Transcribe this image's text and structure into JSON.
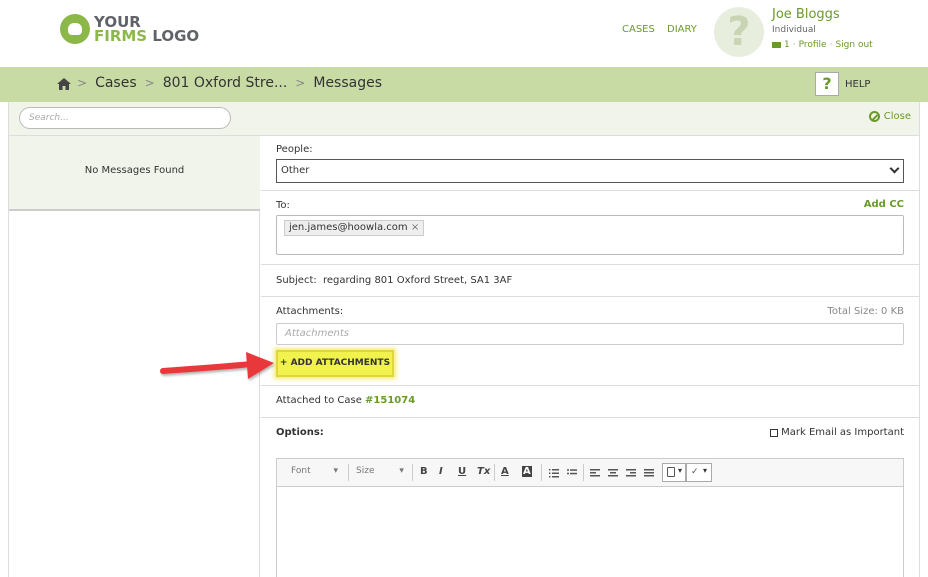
{
  "header": {
    "logo_line1": "YOUR",
    "logo_line2a": "FIRMS",
    "logo_line2b": " LOGO",
    "nav": [
      "CASES",
      "DIARY"
    ],
    "avatar_glyph": "?",
    "user_name": "Joe Bloggs",
    "user_role": "Individual",
    "message_count": "1",
    "profile_label": "Profile",
    "signout_label": "Sign out",
    "separator": "·"
  },
  "breadcrumb": {
    "items": [
      "Cases",
      "801 Oxford Stre...",
      "Messages"
    ],
    "separator": ">",
    "help_glyph": "?",
    "help_label": "HELP"
  },
  "search": {
    "placeholder": "Search...",
    "close_label": "Close"
  },
  "messages_panel": {
    "empty_text": "No Messages Found"
  },
  "form": {
    "people_label": "People:",
    "people_value": "Other",
    "to_label": "To:",
    "add_cc_label": "Add CC",
    "to_tag": "jen.james@hoowla.com",
    "tag_remove": "×",
    "subject_label": "Subject:",
    "subject_value": "regarding 801 Oxford Street, SA1 3AF",
    "attachments_label": "Attachments:",
    "total_size": "Total Size:  0 KB",
    "attachments_placeholder": "Attachments",
    "add_attachments_label": "+ ADD ATTACHMENTS",
    "attached_prefix": "Attached to Case ",
    "case_number": "#151074",
    "options_label": "Options:",
    "important_label": "Mark Email as Important"
  },
  "editor": {
    "font_label": "Font",
    "size_label": "Size",
    "buttons": [
      "B",
      "I",
      "U",
      "Tx",
      "A",
      "A"
    ]
  },
  "colors": {
    "brand_green": "#8cb84a",
    "link_green": "#6a9a2a",
    "crumb_bar": "#c9dba5",
    "highlight_yellow": "#f2f24e",
    "arrow_red": "#e8393a"
  }
}
